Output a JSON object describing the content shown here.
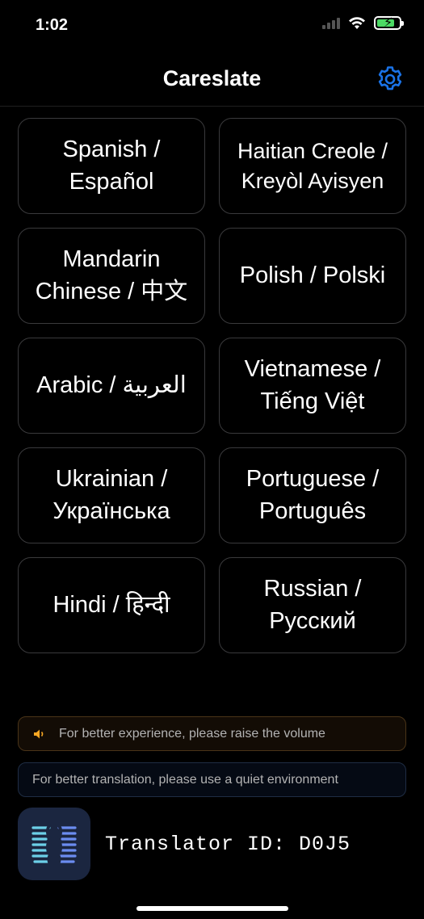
{
  "status_bar": {
    "time": "1:02",
    "battery_level": 0.8,
    "battery_color": "#4cd964",
    "icons": [
      "cellular-icon",
      "wifi-icon",
      "battery-charging-icon"
    ]
  },
  "header": {
    "title": "Careslate",
    "settings_icon": "gear-icon",
    "accent_color": "#1a73e8"
  },
  "languages": [
    {
      "label": "Spanish / Español"
    },
    {
      "label": "Haitian Creole / Kreyòl Ayisyen"
    },
    {
      "label": "Mandarin Chinese / 中文"
    },
    {
      "label": "Polish / Polski"
    },
    {
      "label": "Arabic / العربية"
    },
    {
      "label": "Vietnamese / Tiếng Việt"
    },
    {
      "label": "Ukrainian / Українська"
    },
    {
      "label": "Portuguese / Português"
    },
    {
      "label": "Hindi / हिन्दी"
    },
    {
      "label": "Russian / Русский"
    }
  ],
  "banners": {
    "volume": {
      "text": "For better experience, please raise the volume",
      "icon": "speaker-icon",
      "icon_color": "#f5a623"
    },
    "quiet": {
      "text": "For better translation, please use a quiet environment"
    }
  },
  "footer": {
    "logo_icon": "app-logo-icon",
    "translator_id": "Translator ID: D0J5"
  }
}
